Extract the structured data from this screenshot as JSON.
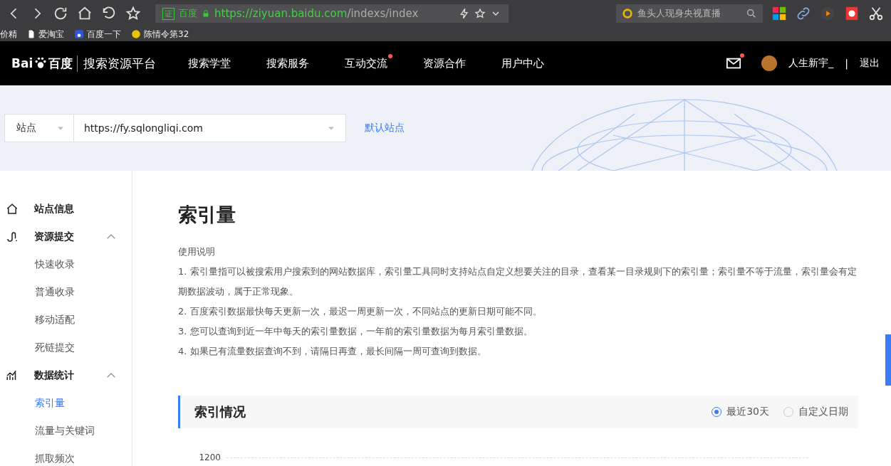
{
  "browser": {
    "cert": "证",
    "site": "百度",
    "url_host": "https://ziyuan.baidu.com",
    "url_path": "/indexs/index",
    "search": "鱼头人现身央视直播",
    "bookmarks": [
      {
        "label": "价精",
        "kind": "text"
      },
      {
        "label": "爱淘宝",
        "kind": "page"
      },
      {
        "label": "百度一下",
        "kind": "paw"
      },
      {
        "label": "陈情令第32",
        "kind": "coin"
      }
    ]
  },
  "nav": {
    "logo_left": "Bai",
    "logo_right": "百度",
    "platform": "搜索资源平台",
    "items": [
      {
        "label": "搜索学堂",
        "badge": false
      },
      {
        "label": "搜索服务",
        "badge": false
      },
      {
        "label": "互动交流",
        "badge": true
      },
      {
        "label": "资源合作",
        "badge": false
      },
      {
        "label": "用户中心",
        "badge": false
      }
    ],
    "mail_badge": true,
    "user": "人生新宇_",
    "separator": "|",
    "logout": "退出"
  },
  "site_bar": {
    "type": "站点",
    "site": "https://fy.sqlongliqi.com",
    "default_link": "默认站点"
  },
  "sidebar": [
    {
      "label": "站点信息"
    },
    {
      "label": "资源提交",
      "expanded": true,
      "children": [
        {
          "label": "快速收录",
          "selected": false
        },
        {
          "label": "普通收录",
          "selected": false
        },
        {
          "label": "移动适配",
          "selected": false
        },
        {
          "label": "死链提交",
          "selected": false
        }
      ]
    },
    {
      "label": "数据统计",
      "expanded": true,
      "children": [
        {
          "label": "索引量",
          "selected": true
        },
        {
          "label": "流量与关键词",
          "selected": false
        },
        {
          "label": "抓取频次",
          "selected": false
        }
      ]
    }
  ],
  "content": {
    "title": "索引量",
    "usage_heading": "使用说明",
    "usage": [
      "1. 索引量指可以被搜索用户搜索到的网站数据库，索引量工具同时支持站点自定义想要关注的目录，查看某一目录规则下的索引量；索引量不等于流量，索引量会有定期数据波动，属于正常现象。",
      "2. 百度索引数据最快每天更新一次，最迟一周更新一次，不同站点的更新日期可能不同。",
      "3. 您可以查询到近一年中每天的索引量数据，一年前的索引量数据为每月索引量数据。",
      "4. 如果已有流量数据查询不到，请隔日再查，最长间隔一周可查询到数据。"
    ],
    "section": "索引情况",
    "ranges": [
      {
        "label": "最近30天",
        "selected": true
      },
      {
        "label": "自定义日期",
        "selected": false
      }
    ],
    "y_tick": "1200"
  }
}
